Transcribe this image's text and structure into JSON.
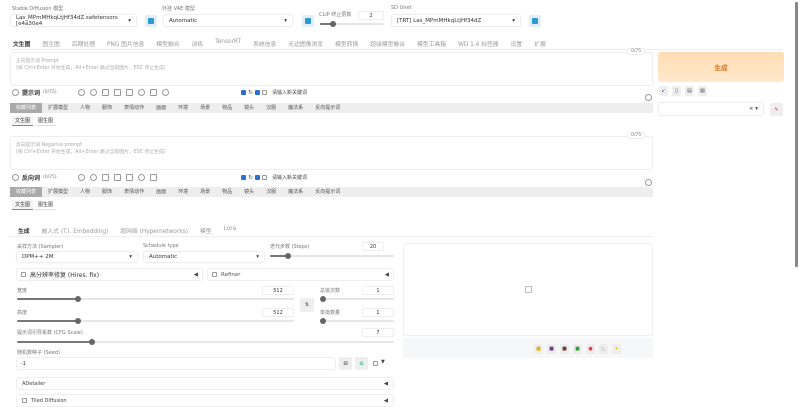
{
  "top": {
    "sd_model": {
      "label": "Stable Diffusion 模型",
      "value": "Las_MPmMHkqLtjHf34dZ.safetensors [e4a30e4"
    },
    "vae": {
      "label": "外挂 VAE 模型",
      "value": "Automatic"
    },
    "clip": {
      "label": "CLIP 终止层数",
      "value": "2",
      "fraction": 0.17
    },
    "unet": {
      "label": "SD Unet",
      "value": "[TRT] Las_MPmMHkqLtjHf34dZ"
    }
  },
  "tabs": [
    "文生图",
    "图生图",
    "后期处理",
    "PNG 图片信息",
    "模型融合",
    "训练",
    "TensorRT",
    "系统信息",
    "无边图像浏览",
    "模型转换",
    "超级模型融合",
    "模型工具箱",
    "WD 1.4 标签器",
    "设置",
    "扩展"
  ],
  "prompt": {
    "placeholder": "正向提示词 Prompt\n(按 Ctrl+Enter 开始生成，Alt+Enter 跳过当前图片，ESC 停止生成)",
    "counter": "0/75",
    "title": "提示词",
    "count": "(0/75)",
    "keyword_placeholder": "请输入新关键词"
  },
  "negative": {
    "placeholder": "反向提示词 Negative prompt\n(按 Ctrl+Enter 开始生成，Alt+Enter 跳过当前图片，ESC 停止生成)",
    "counter": "0/75",
    "title": "反向词",
    "count": "(0/75)",
    "keyword_placeholder": "请输入新关键词"
  },
  "categories": [
    "收藏列表",
    "扩展模型",
    "人物",
    "服饰",
    "表情动作",
    "画面",
    "环境",
    "场景",
    "物品",
    "镜头",
    "汉服",
    "魔法系",
    "反向提示词"
  ],
  "sub_tabs": [
    "文生图",
    "图生图"
  ],
  "generate": {
    "label": "生成",
    "color": "#ffe0bb"
  },
  "param_tabs": [
    "生成",
    "嵌入式 (T.I. Embedding)",
    "超网络 (Hypernetworks)",
    "模型",
    "Lora"
  ],
  "params": {
    "sampler": {
      "label": "采样方法 (Sampler)",
      "value": "DPM++ 2M"
    },
    "schedule": {
      "label": "Schedule type",
      "value": "Automatic"
    },
    "steps": {
      "label": "迭代步数 (Steps)",
      "value": "20",
      "fraction": 0.13
    },
    "hires": "高分辨率修复 (Hires. fix)",
    "refiner": "Refiner",
    "width": {
      "label": "宽度",
      "value": "512",
      "fraction": 0.22
    },
    "height": {
      "label": "高度",
      "value": "512",
      "fraction": 0.22
    },
    "batch_count": {
      "label": "总批次数",
      "value": "1",
      "fraction": 0
    },
    "batch_size": {
      "label": "单批数量",
      "value": "1",
      "fraction": 0
    },
    "cfg": {
      "label": "提示词引导系数 (CFG Scale)",
      "value": "7",
      "fraction": 0.2
    },
    "seed": {
      "label": "随机数种子 (Seed)",
      "value": "-1"
    },
    "adetailer": "ADetailer",
    "tiled": "Tiled Diffusion"
  }
}
